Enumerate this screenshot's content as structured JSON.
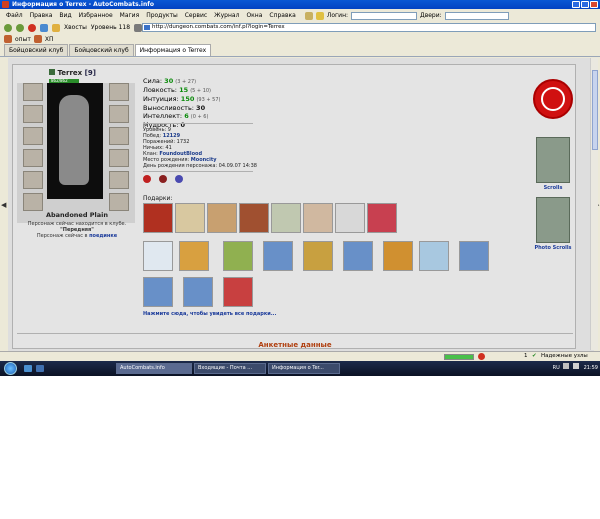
{
  "window": {
    "title": "Информация о Terrex - AutoCombats.info"
  },
  "menu": [
    "Файл",
    "Правка",
    "Вид",
    "Избранное",
    "Магия",
    "Продукты",
    "Сервис",
    "Журнал",
    "Окна",
    "Справка"
  ],
  "toolbar": {
    "login_label": "Логин:",
    "doors_label": "Двери:",
    "favorites_label": "Хвосты",
    "level_label": "Уровень 118"
  },
  "address": {
    "url": "http://dungeon.combats.com/inf.pl?login=Terrex"
  },
  "links": {
    "item1": "опыт",
    "item2": "ХП"
  },
  "tabs": [
    "Бойцовский клуб",
    "Бойцовский клуб",
    "Информация о Terrex"
  ],
  "character": {
    "name": "Terrex",
    "level": "[9]",
    "hp": "862/862"
  },
  "stats": [
    {
      "label": "Сила:",
      "value": "30",
      "extra": "(3 + 27)"
    },
    {
      "label": "Ловкость:",
      "value": "15",
      "extra": "(5 + 10)"
    },
    {
      "label": "Интуиция:",
      "value": "150",
      "extra": "(93 + 57)"
    },
    {
      "label": "Выносливость:",
      "value": "30",
      "extra": ""
    },
    {
      "label": "Интеллект:",
      "value": "6",
      "extra": "(0 + 6)"
    },
    {
      "label": "Мудрость:",
      "value": "0",
      "extra": ""
    }
  ],
  "info": {
    "level": "Уровень: 9",
    "wins_label": "Побед:",
    "wins": "12129",
    "losses": "Поражений: 1732",
    "draws": "Ничьих: 41",
    "clan_label": "Клан:",
    "clan": "FoundoutBlood",
    "birthplace_label": "Место рождения:",
    "birthplace": "Mooncity",
    "birthday": "День рождения персонажа: 04.09.07 14:38"
  },
  "location": {
    "place": "Abandoned Plain",
    "line1": "Персонаж сейчас находится в клубе.",
    "line2": "\"Передняя\"",
    "line3": "Персонаж сейчас в",
    "line3_link": "поединке"
  },
  "gifts": {
    "label": "Подарки:",
    "see_all": "Нажмите сюда, чтобы увидеть все подарки..."
  },
  "banners": {
    "scrolls": "Scrolls",
    "photo_scrolls": "Photo Scrolls"
  },
  "section": {
    "anketa": "Анкетные данные"
  },
  "status": {
    "zone": "Надежные узлы",
    "count": "1"
  },
  "taskbar": {
    "tasks": [
      "AutoCombats.info",
      "Входящие - Почта ...",
      "Информация о Ter..."
    ],
    "lang": "RU",
    "time": "21:59"
  }
}
